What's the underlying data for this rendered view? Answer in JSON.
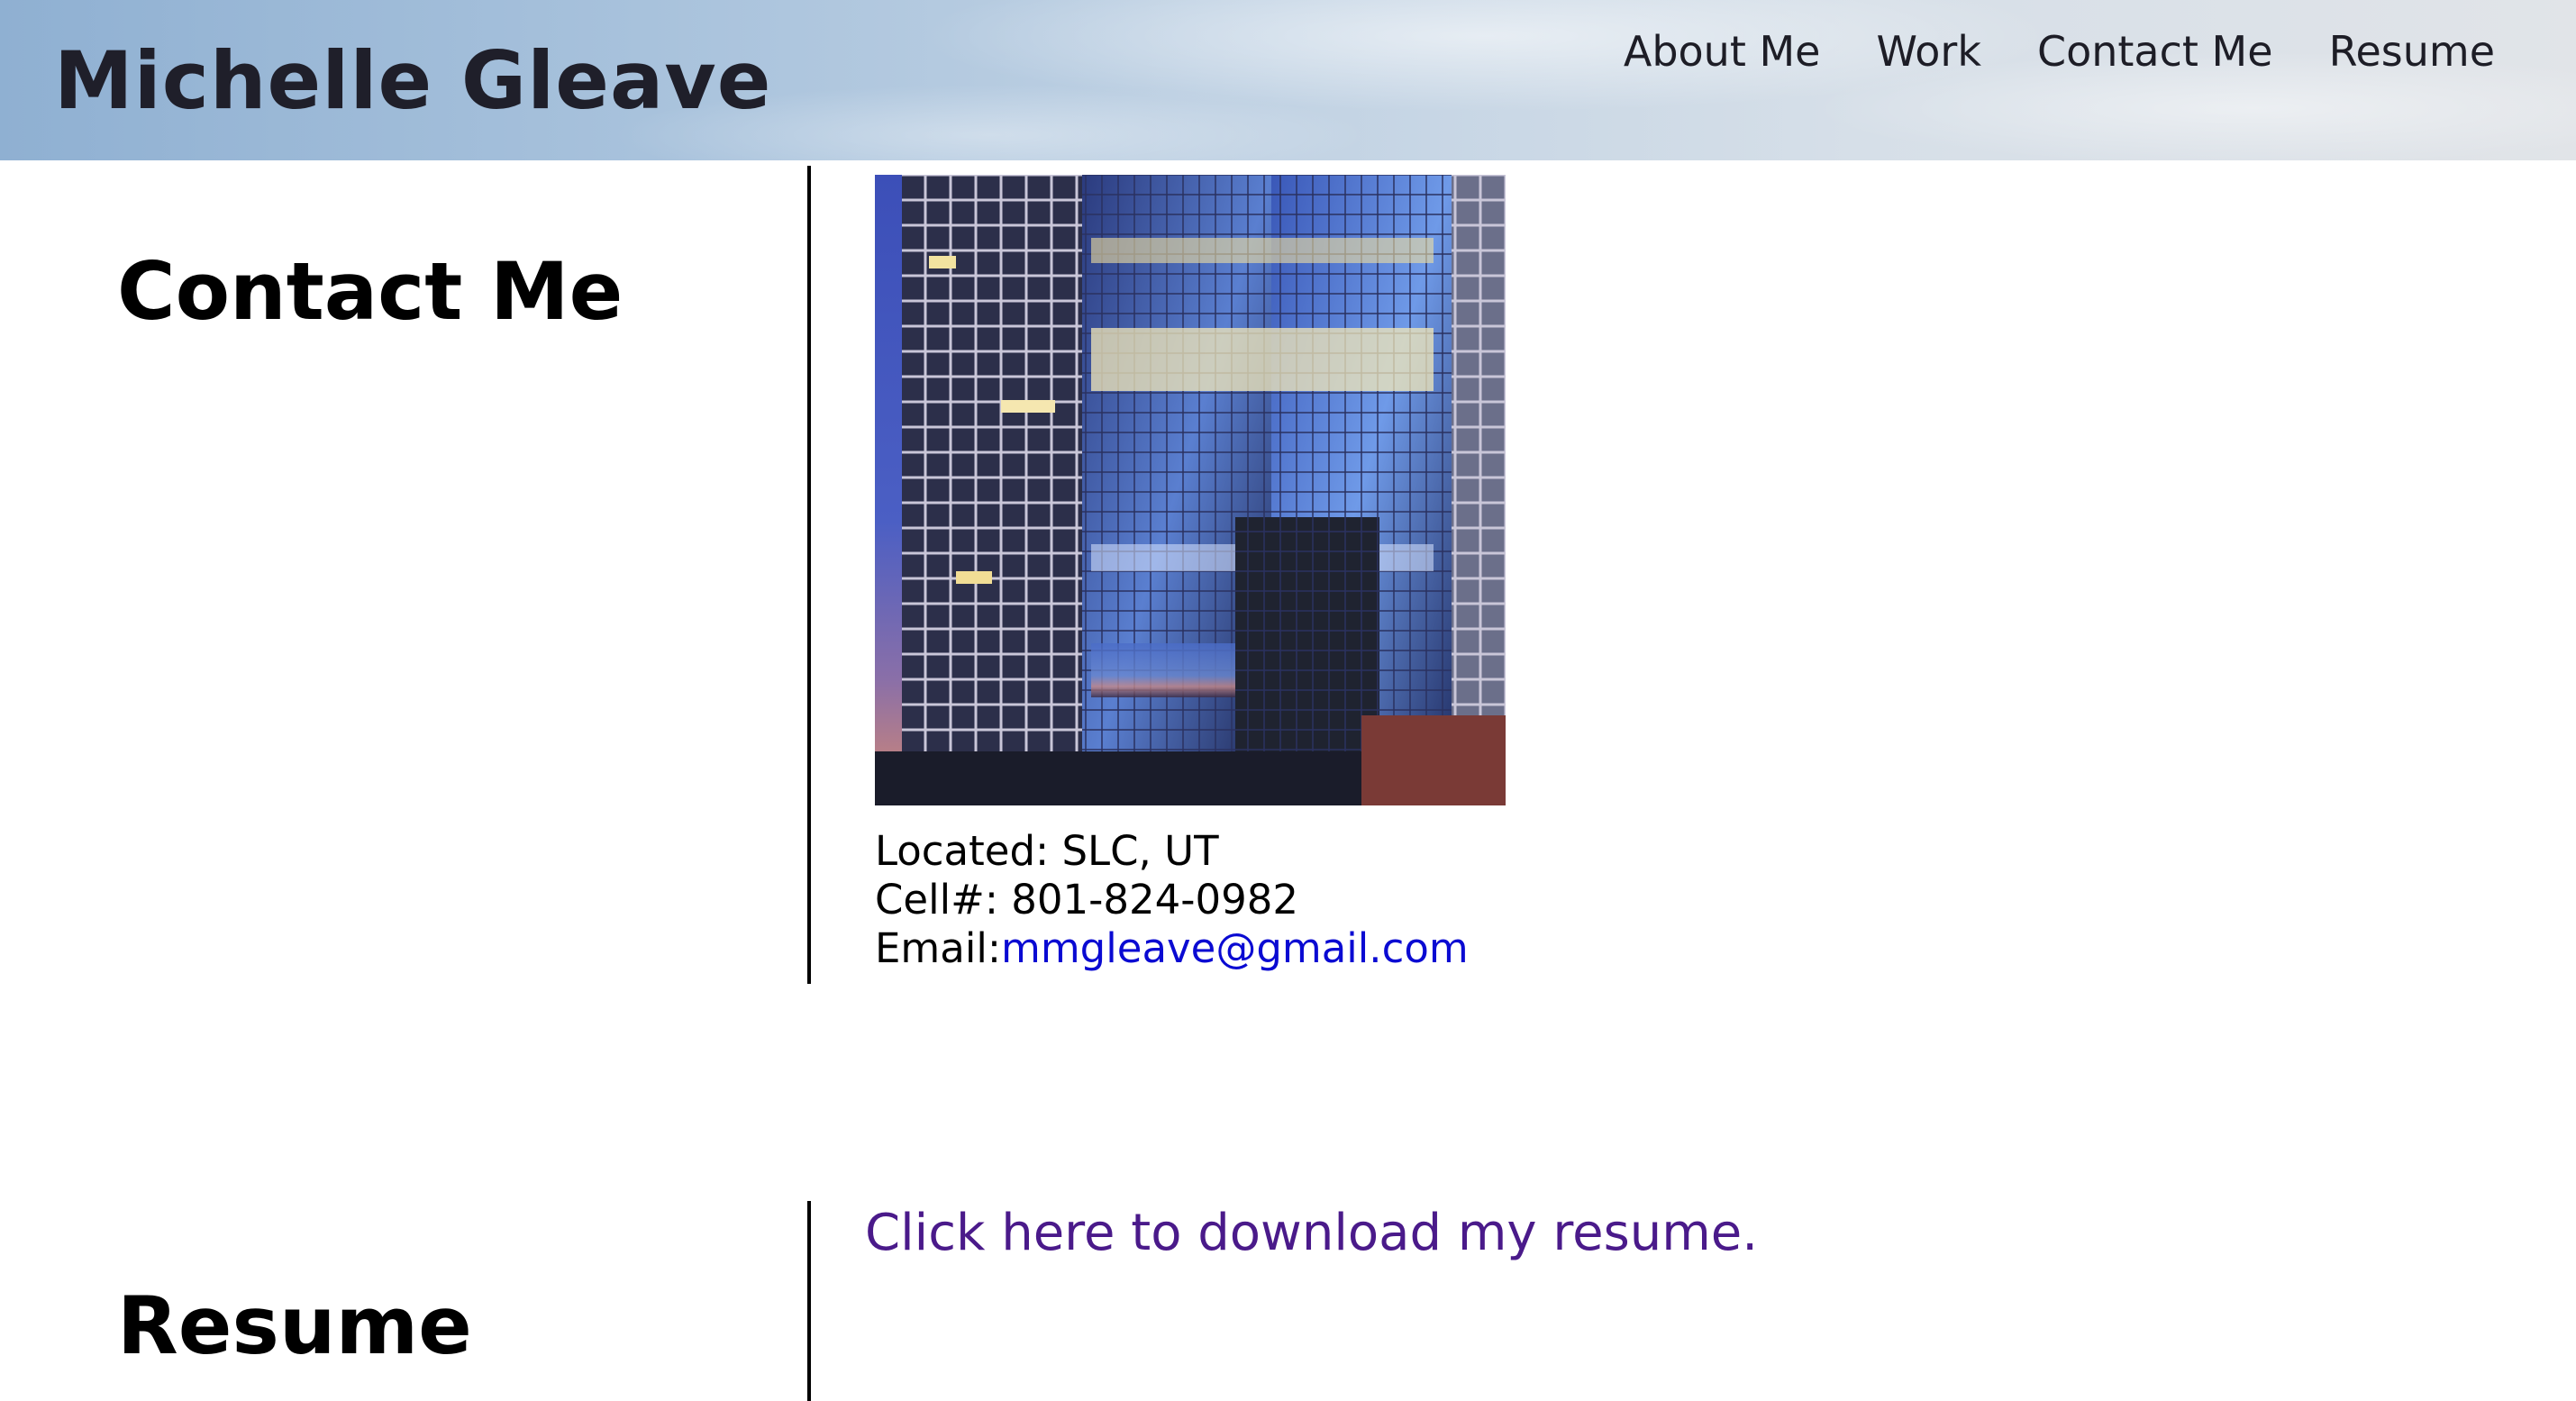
{
  "header": {
    "site_title": "Michelle Gleave",
    "nav": [
      "About Me",
      "Work",
      "Contact Me",
      "Resume"
    ]
  },
  "contact": {
    "heading": "Contact Me",
    "located_label": "Located: SLC, UT",
    "cell_label": "Cell#: 801-824-0982",
    "email_label": "Email:",
    "email": "mmgleave@gmail.com"
  },
  "resume": {
    "heading": "Resume",
    "download_link": "Click here to download my resume."
  }
}
